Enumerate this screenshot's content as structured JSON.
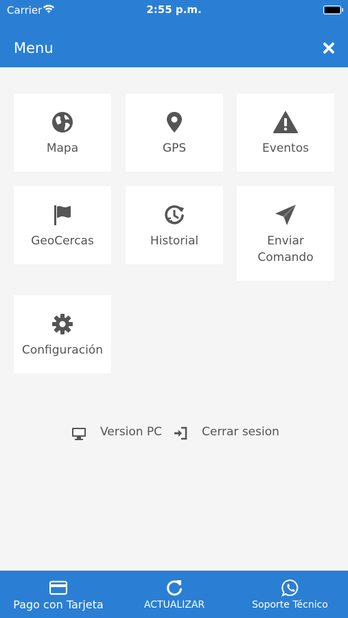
{
  "status_bar": {
    "carrier": "Carrier",
    "time": "2:55 p.m."
  },
  "header": {
    "title": "Menu",
    "close_icon": "close-icon"
  },
  "tiles": [
    {
      "label": "Mapa",
      "icon": "globe-icon"
    },
    {
      "label": "GPS",
      "icon": "map-pin-icon"
    },
    {
      "label": "Eventos",
      "icon": "warning-icon"
    },
    {
      "label": "GeoCercas",
      "icon": "flag-icon"
    },
    {
      "label": "Historial",
      "icon": "history-icon"
    },
    {
      "label": "Enviar Comando",
      "icon": "send-icon"
    },
    {
      "label": "Configuración",
      "icon": "gear-icon"
    }
  ],
  "links": {
    "version_pc": "Version PC",
    "cerrar_sesion": "Cerrar sesion"
  },
  "bottom_bar": {
    "pago": "Pago con Tarjeta",
    "actualizar": "ACTUALIZAR",
    "soporte": "Soporte Técnico"
  },
  "colors": {
    "primary": "#2a7fd4",
    "background": "#f5f5f5",
    "tile": "#ffffff",
    "icon": "#555555"
  }
}
